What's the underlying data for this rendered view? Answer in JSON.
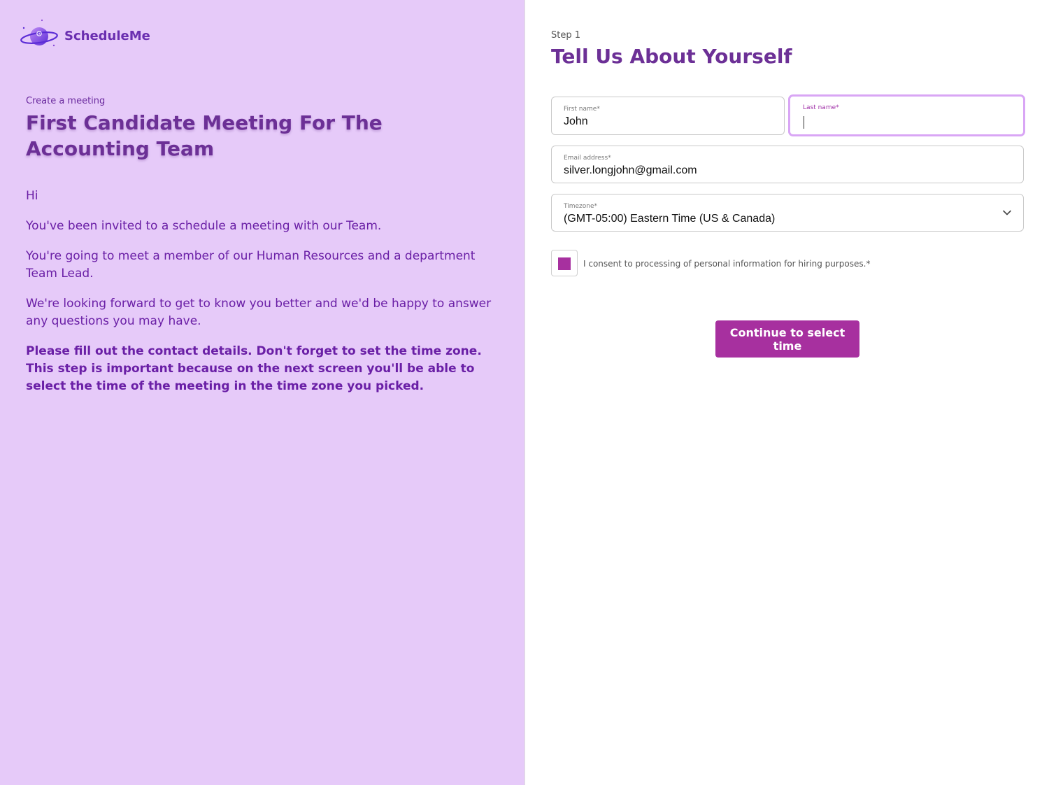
{
  "brand": {
    "name": "ScheduleMe",
    "logo_icon": "planet-clock-icon"
  },
  "meeting": {
    "eyebrow": "Create a meeting",
    "title": "First Candidate Meeting For The Accounting Team",
    "paragraphs": [
      "Hi",
      "You've been invited to a schedule a meeting with our Team.",
      "You're going to meet a member of our Human Resources and a department Team Lead.",
      "We're looking forward to get to know you better and we'd be happy to answer any questions you may have."
    ],
    "instructions": "Please fill out the contact details. Don't forget to set the time zone. This step is important because on the next screen you'll be able to select the time of the meeting in the time zone you picked."
  },
  "form": {
    "step_label": "Step 1",
    "title": "Tell Us About Yourself",
    "first_name": {
      "label": "First name*",
      "value": "John"
    },
    "last_name": {
      "label": "Last name*",
      "value": ""
    },
    "email": {
      "label": "Email address*",
      "value": "silver.longjohn@gmail.com"
    },
    "timezone": {
      "label": "Timezone*",
      "value": "(GMT-05:00) Eastern Time (US & Canada)",
      "icon": "chevron-down-icon"
    },
    "consent": {
      "label": "I consent to processing of personal information for hiring purposes.*",
      "checked": true
    },
    "continue_label": "Continue to select time"
  },
  "colors": {
    "left_panel_bg": "#e6caf9",
    "heading": "#6c3096",
    "body_text": "#6a1fa6",
    "accent": "#a7309f",
    "focus_ring": "#d9a6f5"
  }
}
